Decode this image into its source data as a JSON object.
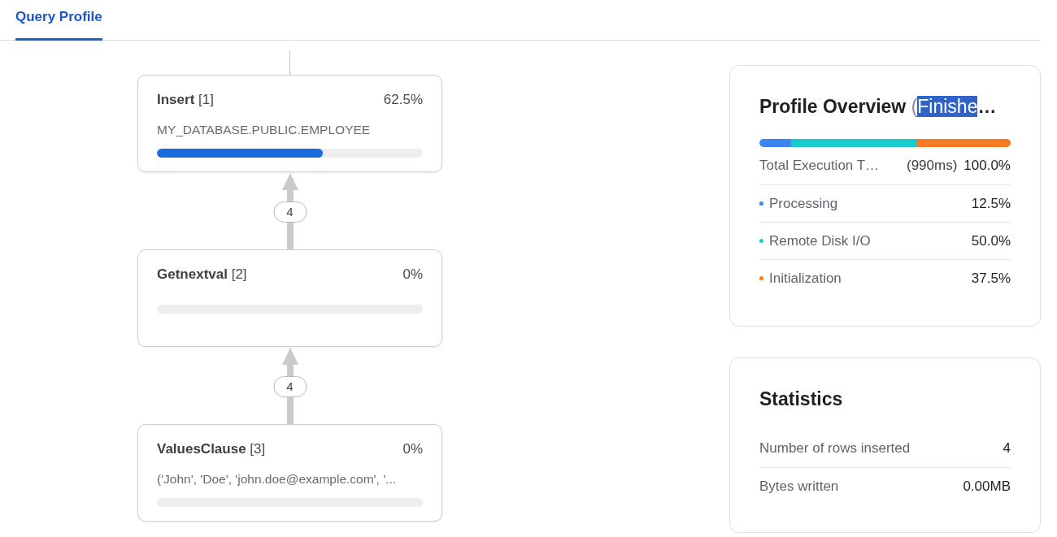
{
  "tabs": [
    {
      "label": "Query Profile",
      "selected": true
    }
  ],
  "operator_tree": {
    "nodes": [
      {
        "name": "Insert",
        "index": "[1]",
        "percent": "62.5%",
        "detail": "MY_DATABASE.PUBLIC.EMPLOYEE",
        "level": 0.625,
        "input_rows": "4"
      },
      {
        "name": "Getnextval",
        "index": "[2]",
        "percent": "0%",
        "input_rows": "4"
      },
      {
        "name": "ValuesClause",
        "index": "[3]",
        "percent": "0%",
        "detail": "('John', 'Doe', 'john.doe@example.com', '..."
      }
    ]
  },
  "overview": {
    "title": "Profile Overview",
    "status_parts": [
      {
        "text": "(",
        "highlighted": false
      },
      {
        "text": "Finishe",
        "highlighted": true
      },
      {
        "text": "…",
        "highlighted": false
      }
    ],
    "total": {
      "label": "Total Execution T…",
      "duration": "(990ms)",
      "percent": "100.0%"
    },
    "breakdown": [
      {
        "label": "Processing",
        "percent": "12.5%",
        "color": "#3d86f2"
      },
      {
        "label": "Remote Disk I/O",
        "percent": "50.0%",
        "color": "#16cccc"
      },
      {
        "label": "Initialization",
        "percent": "37.5%",
        "color": "#f77b22"
      }
    ]
  },
  "statistics": {
    "title": "Statistics",
    "rows": [
      {
        "label": "Number of rows inserted",
        "value": "4"
      },
      {
        "label": "Bytes written",
        "value": "0.00MB"
      }
    ]
  }
}
